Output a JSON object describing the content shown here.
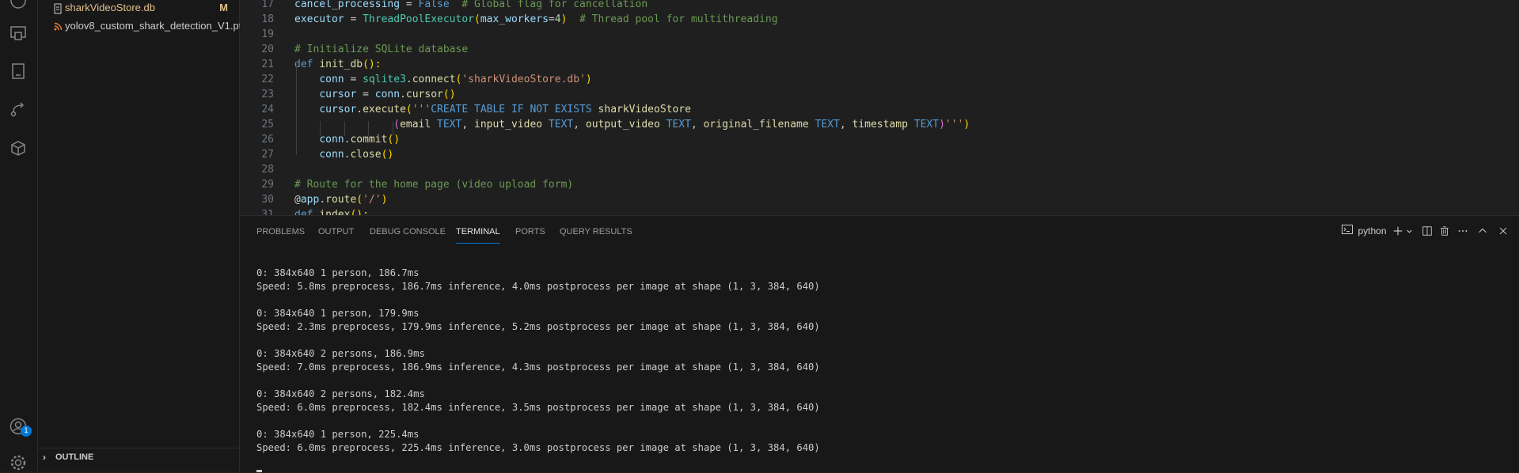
{
  "colors": {
    "keyword": "#569cd6",
    "function": "#dcdcaa",
    "string": "#ce9178",
    "comment": "#6a9955",
    "variable": "#9cdcfe",
    "class": "#4ec9b0",
    "number": "#b5cea8",
    "paren": "#ffd700",
    "paren2": "#da70d6",
    "accent": "#0078d4",
    "modified": "#e2c08d"
  },
  "activity_bar": {
    "icons": [
      "accounts-icon",
      "remote-explorer-icon",
      "book-icon",
      "source-control-flow-icon",
      "extensions-box-icon",
      "account-icon",
      "settings-gear-icon"
    ],
    "account_badge": "1"
  },
  "sidebar": {
    "files": [
      {
        "name": "sharkVideoStore.db",
        "status": "M",
        "icon": "database-file-icon",
        "color": "#e2c08d"
      },
      {
        "name": "yolov8_custom_shark_detection_V1.pt",
        "status": "",
        "icon": "rss-file-icon",
        "color": "#cccccc"
      }
    ],
    "outline_label": "OUTLINE"
  },
  "editor": {
    "lines": [
      {
        "n": "17",
        "tokens": [
          [
            "cancel_processing",
            "variable"
          ],
          [
            " = ",
            "plain"
          ],
          [
            "False",
            "keyword"
          ],
          [
            "  ",
            "plain"
          ],
          [
            "# Global flag for cancellation",
            "comment"
          ]
        ]
      },
      {
        "n": "18",
        "tokens": [
          [
            "executor",
            "variable"
          ],
          [
            " = ",
            "plain"
          ],
          [
            "ThreadPoolExecutor",
            "class"
          ],
          [
            "(",
            "paren"
          ],
          [
            "max_workers",
            "variable"
          ],
          [
            "=",
            "plain"
          ],
          [
            "4",
            "number"
          ],
          [
            ")",
            "paren"
          ],
          [
            "  ",
            "plain"
          ],
          [
            "# Thread pool for multithreading",
            "comment"
          ]
        ]
      },
      {
        "n": "19",
        "tokens": []
      },
      {
        "n": "20",
        "tokens": [
          [
            "# Initialize SQLite database",
            "comment"
          ]
        ]
      },
      {
        "n": "21",
        "tokens": [
          [
            "def",
            "keyword"
          ],
          [
            " ",
            "plain"
          ],
          [
            "init_db",
            "function"
          ],
          [
            "():",
            "paren"
          ]
        ]
      },
      {
        "n": "22",
        "tokens": [
          [
            "    ",
            "plain"
          ],
          [
            "conn",
            "variable"
          ],
          [
            " = ",
            "plain"
          ],
          [
            "sqlite3",
            "class"
          ],
          [
            ".",
            "plain"
          ],
          [
            "connect",
            "function"
          ],
          [
            "(",
            "paren"
          ],
          [
            "'sharkVideoStore.db'",
            "string"
          ],
          [
            ")",
            "paren"
          ]
        ]
      },
      {
        "n": "23",
        "tokens": [
          [
            "    ",
            "plain"
          ],
          [
            "cursor",
            "variable"
          ],
          [
            " = ",
            "plain"
          ],
          [
            "conn",
            "variable"
          ],
          [
            ".",
            "plain"
          ],
          [
            "cursor",
            "function"
          ],
          [
            "()",
            "paren"
          ]
        ]
      },
      {
        "n": "24",
        "tokens": [
          [
            "    ",
            "plain"
          ],
          [
            "cursor",
            "variable"
          ],
          [
            ".",
            "plain"
          ],
          [
            "execute",
            "function"
          ],
          [
            "(",
            "paren"
          ],
          [
            "'''",
            "string"
          ],
          [
            "CREATE TABLE IF NOT EXISTS",
            "keyword"
          ],
          [
            " ",
            "plain"
          ],
          [
            "sharkVideoStore",
            "function"
          ]
        ]
      },
      {
        "n": "25",
        "tokens": [
          [
            "                ",
            "plain"
          ],
          [
            "(",
            "paren2"
          ],
          [
            "email",
            "function"
          ],
          [
            " ",
            "plain"
          ],
          [
            "TEXT",
            "keyword"
          ],
          [
            ", ",
            "plain"
          ],
          [
            "input_video",
            "function"
          ],
          [
            " ",
            "plain"
          ],
          [
            "TEXT",
            "keyword"
          ],
          [
            ", ",
            "plain"
          ],
          [
            "output_video",
            "function"
          ],
          [
            " ",
            "plain"
          ],
          [
            "TEXT",
            "keyword"
          ],
          [
            ", ",
            "plain"
          ],
          [
            "original_filename",
            "function"
          ],
          [
            " ",
            "plain"
          ],
          [
            "TEXT",
            "keyword"
          ],
          [
            ", ",
            "plain"
          ],
          [
            "timestamp",
            "function"
          ],
          [
            " ",
            "plain"
          ],
          [
            "TEXT",
            "keyword"
          ],
          [
            ")",
            "paren2"
          ],
          [
            "'''",
            "string"
          ],
          [
            ")",
            "paren"
          ]
        ]
      },
      {
        "n": "26",
        "tokens": [
          [
            "    ",
            "plain"
          ],
          [
            "conn",
            "variable"
          ],
          [
            ".",
            "plain"
          ],
          [
            "commit",
            "function"
          ],
          [
            "()",
            "paren"
          ]
        ]
      },
      {
        "n": "27",
        "tokens": [
          [
            "    ",
            "plain"
          ],
          [
            "conn",
            "variable"
          ],
          [
            ".",
            "plain"
          ],
          [
            "close",
            "function"
          ],
          [
            "()",
            "paren"
          ]
        ]
      },
      {
        "n": "28",
        "tokens": []
      },
      {
        "n": "29",
        "tokens": [
          [
            "# Route for the home page (video upload form)",
            "comment"
          ]
        ]
      },
      {
        "n": "30",
        "tokens": [
          [
            "@",
            "plain"
          ],
          [
            "app",
            "variable"
          ],
          [
            ".",
            "plain"
          ],
          [
            "route",
            "function"
          ],
          [
            "(",
            "paren"
          ],
          [
            "'/'",
            "string"
          ],
          [
            ")",
            "paren"
          ]
        ]
      },
      {
        "n": "31",
        "tokens": [
          [
            "def",
            "keyword"
          ],
          [
            " ",
            "plain"
          ],
          [
            "index",
            "function"
          ],
          [
            "():",
            "paren"
          ]
        ]
      }
    ]
  },
  "panel": {
    "tabs": [
      {
        "label": "PROBLEMS",
        "active": false
      },
      {
        "label": "OUTPUT",
        "active": false
      },
      {
        "label": "DEBUG CONSOLE",
        "active": false
      },
      {
        "label": "TERMINAL",
        "active": true
      },
      {
        "label": "PORTS",
        "active": false
      },
      {
        "label": "QUERY RESULTS",
        "active": false
      }
    ],
    "terminal_name": "python",
    "toolbar_icons": [
      "terminal-icon",
      "add-terminal-icon",
      "launch-profile-chevron-icon",
      "split-terminal-icon",
      "trash-icon",
      "more-actions-icon",
      "maximize-panel-icon",
      "close-panel-icon"
    ]
  },
  "terminal": {
    "lines": [
      "0: 384x640 1 person, 186.7ms",
      "Speed: 5.8ms preprocess, 186.7ms inference, 4.0ms postprocess per image at shape (1, 3, 384, 640)",
      "",
      "0: 384x640 1 person, 179.9ms",
      "Speed: 2.3ms preprocess, 179.9ms inference, 5.2ms postprocess per image at shape (1, 3, 384, 640)",
      "",
      "0: 384x640 2 persons, 186.9ms",
      "Speed: 7.0ms preprocess, 186.9ms inference, 4.3ms postprocess per image at shape (1, 3, 384, 640)",
      "",
      "0: 384x640 2 persons, 182.4ms",
      "Speed: 6.0ms preprocess, 182.4ms inference, 3.5ms postprocess per image at shape (1, 3, 384, 640)",
      "",
      "0: 384x640 1 person, 225.4ms",
      "Speed: 6.0ms preprocess, 225.4ms inference, 3.0ms postprocess per image at shape (1, 3, 384, 640)"
    ]
  }
}
